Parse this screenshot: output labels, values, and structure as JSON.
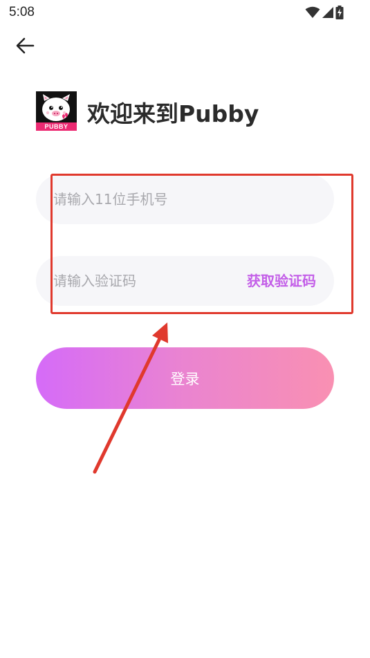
{
  "status_bar": {
    "time": "5:08",
    "icons": [
      "wifi-icon",
      "signal-icon",
      "battery-charging-icon"
    ]
  },
  "nav": {
    "back_icon": "arrow-left-icon"
  },
  "header": {
    "logo_text": "PUBBY",
    "title": "欢迎来到Pubby"
  },
  "form": {
    "phone_placeholder": "请输入11位手机号",
    "code_placeholder": "请输入验证码",
    "get_code_label": "获取验证码",
    "login_label": "登录"
  },
  "colors": {
    "accent": "#c35ee8",
    "button_gradient_start": "#d56bf8",
    "button_gradient_end": "#f990b2",
    "input_bg": "#f6f6f9",
    "annotation": "#e0392d",
    "logo_banner": "#ec2a72"
  }
}
